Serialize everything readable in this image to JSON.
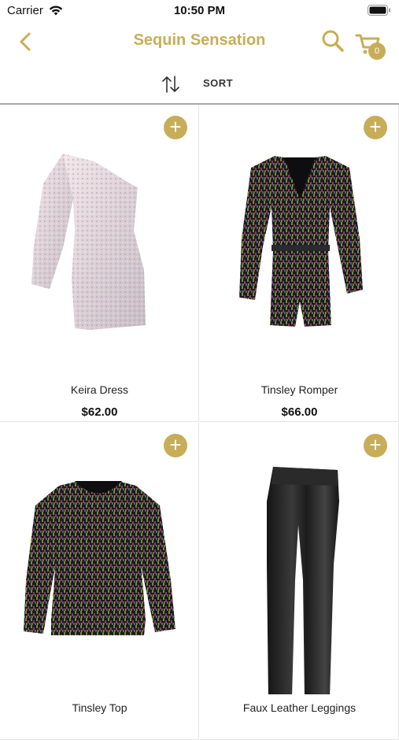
{
  "status_bar": {
    "carrier": "Carrier",
    "time": "10:50 PM"
  },
  "nav": {
    "title": "Sequin Sensation",
    "cart_count": "0"
  },
  "sort": {
    "label": "SORT"
  },
  "colors": {
    "accent": "#c8ad58"
  },
  "products": [
    {
      "name": "Keira Dress",
      "price": "$62.00",
      "add_label": "+"
    },
    {
      "name": "Tinsley Romper",
      "price": "$66.00",
      "add_label": "+"
    },
    {
      "name": "Tinsley Top",
      "price": "",
      "add_label": "+"
    },
    {
      "name": "Faux Leather Leggings",
      "price": "",
      "add_label": "+"
    }
  ],
  "icons": [
    "wifi-icon",
    "battery-icon",
    "back-chevron-icon",
    "search-icon",
    "cart-icon",
    "sort-arrows-icon",
    "plus-icon"
  ]
}
